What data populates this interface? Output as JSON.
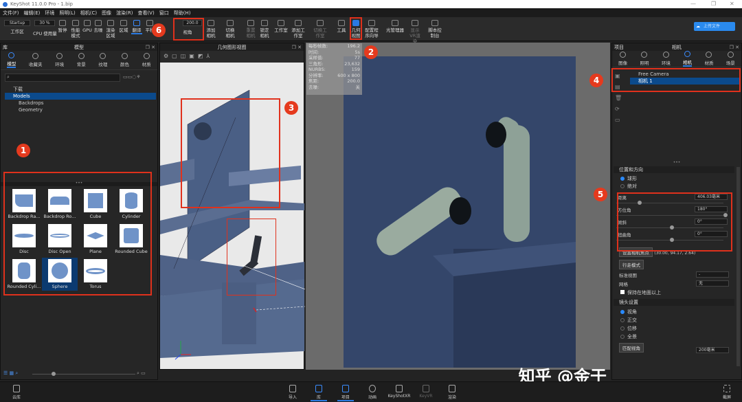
{
  "app": {
    "title": "KeyShot 11.0.0 Pro  - 1.bip"
  },
  "menu": [
    "文件(F)",
    "编辑(E)",
    "环境",
    "照明(L)",
    "相机(C)",
    "图像",
    "渲染(R)",
    "查看(V)",
    "窗口",
    "帮助(H)"
  ],
  "toolbar": {
    "workspace_value": "Startup",
    "workspace_label": "工作区",
    "cpu_value": "30 %",
    "items": [
      "CPU 使用量",
      "暂停",
      "性能模式",
      "GPU",
      "去噪",
      "渲染区域",
      "区域",
      "翻译",
      "平移"
    ],
    "fov_value": "200.0",
    "fov_label": "视角",
    "add_camera": "添加相机",
    "switch_camera": "切换相机",
    "reset_camera": "重置相机",
    "lock_camera": "锁定相机",
    "studio": "工作室",
    "add_studio": "添加工作室",
    "switch_studio": "切换工作室",
    "tools": "工具",
    "geometry_view": "几何视图",
    "configurator": "配置程序向导",
    "light_manager": "光管理器",
    "vr": "显示VR渲染",
    "script": "脚本控制台",
    "cloud_badge": "上传文件"
  },
  "library": {
    "panel_left": "库",
    "title": "模型",
    "tabs": [
      "模型",
      "收藏夹",
      "环境",
      "背景",
      "纹理",
      "颜色",
      "材质"
    ],
    "search_placeholder": "",
    "tree": [
      "下载",
      "Models",
      "Backdrops",
      "Geometry"
    ],
    "models": [
      "Backdrop Ra...",
      "Backdrop Ro...",
      "Cube",
      "Cylinder",
      "Disc",
      "Disc Open",
      "Plane",
      "Rounded Cube",
      "Rounded Cyli...",
      "Sphere",
      "Torus"
    ],
    "selected_model": "Sphere"
  },
  "geometry_view": {
    "title": "几何图形视图"
  },
  "stats": [
    [
      "每秒帧数:",
      "196.2"
    ],
    [
      "时间:",
      "5s"
    ],
    [
      "采样值:",
      "77"
    ],
    [
      "三角形:",
      "23,632"
    ],
    [
      "NURBS:",
      "159"
    ],
    [
      "分辨率:",
      "600 x 800"
    ],
    [
      "焦距:",
      "200.0"
    ],
    [
      "去噪:",
      "关"
    ]
  ],
  "project": {
    "panel_left": "项目",
    "title": "相机",
    "tabs": [
      "图像",
      "照明",
      "环境",
      "相机",
      "材质",
      "场景"
    ],
    "cameras": [
      "Free Camera",
      "相机 1"
    ],
    "pos_section": "位置和方向",
    "mode_options": [
      "球形",
      "绝对"
    ],
    "props": [
      {
        "label": "距离",
        "value": "406.03毫米",
        "pct": 0.2
      },
      {
        "label": "方位角",
        "value": "180°",
        "pct": 1.0
      },
      {
        "label": "倾斜",
        "value": "0°",
        "pct": 0.5
      },
      {
        "label": "扭曲角",
        "value": "0°",
        "pct": 0.5
      }
    ],
    "set_pivot": "设置相机焦点",
    "pivot_coords": "(30.00, 94.17, 2.64)",
    "walk_mode": "行走模式",
    "std_view_label": "标准视图",
    "std_view_value": "-",
    "grid_label": "网格",
    "grid_value": "无",
    "keep_above": "保持在地面以上",
    "lens_section": "镜头设置",
    "lens_options": [
      "视角",
      "正交",
      "位移",
      "全景"
    ],
    "match_persp": "匹配视角",
    "focal_value": "200毫米"
  },
  "bottom": {
    "cloud": "云库",
    "import": "导入",
    "library": "库",
    "project": "项目",
    "animation": "动画",
    "keyshotxr": "KeyShotXR",
    "keyvr": "KeyVR",
    "render": "渲染",
    "screenshot": "截屏"
  },
  "annotations": [
    "1",
    "2",
    "3",
    "4",
    "5",
    "6"
  ],
  "watermark": "知乎 @金于",
  "colors": {
    "accent": "#2a7ae2",
    "annotation": "#e0311c",
    "selection": "#0b4a8c"
  }
}
